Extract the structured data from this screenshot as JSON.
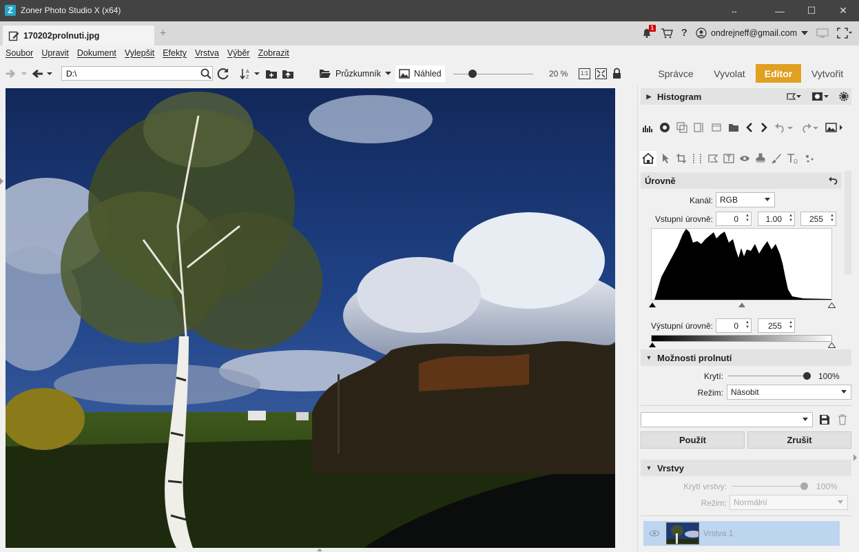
{
  "window": {
    "title": "Zoner Photo Studio X (x64)",
    "restore_glyph": "↔",
    "minimize_glyph": "—",
    "maximize_glyph": "☐",
    "close_glyph": "✕"
  },
  "tabbar": {
    "document_tab": "170202prolnuti.jpg",
    "add_tab_glyph": "+",
    "notification_count": "1",
    "help_glyph": "?",
    "account": "ondrejneff@gmail.com"
  },
  "menu": [
    "Soubor",
    "Upravit",
    "Dokument",
    "Vylepšit",
    "Efekty",
    "Vrstva",
    "Výběr",
    "Zobrazit"
  ],
  "toolbar": {
    "path": "D:\\",
    "explorer_label": "Průzkumník",
    "preview_label": "Náhled",
    "zoom_percent": 20,
    "zoom_text": "20 %",
    "one_to_one": "1:1",
    "modes": [
      "Správce",
      "Vyvolat",
      "Editor",
      "Vytvořit"
    ],
    "active_mode": "Editor"
  },
  "panel": {
    "histogram_title": "Histogram",
    "levels": {
      "title": "Úrovně",
      "channel_label": "Kanál:",
      "channel_value": "RGB",
      "input_label": "Vstupní úrovně:",
      "input_black": "0",
      "input_gamma": "1.00",
      "input_white": "255",
      "output_label": "Výstupní úrovně:",
      "output_black": "0",
      "output_white": "255"
    },
    "blend": {
      "title": "Možnosti prolnutí",
      "opacity_label": "Krytí:",
      "opacity_value": "100%",
      "mode_label": "Režim:",
      "mode_value": "Násobit"
    },
    "preset_value": "",
    "apply_label": "Použít",
    "cancel_label": "Zrušit",
    "layers": {
      "title": "Vrstvy",
      "opacity_label": "Krytí vrstvy:",
      "opacity_value": "100%",
      "mode_label": "Režim:",
      "mode_value": "Normální",
      "items": [
        {
          "name": "Vrstva 1"
        }
      ]
    }
  },
  "colors": {
    "titlebar": "#434343",
    "accent_editor": "#e0a020",
    "layer_selected": "#bdd5ee",
    "badge": "#d20000"
  }
}
